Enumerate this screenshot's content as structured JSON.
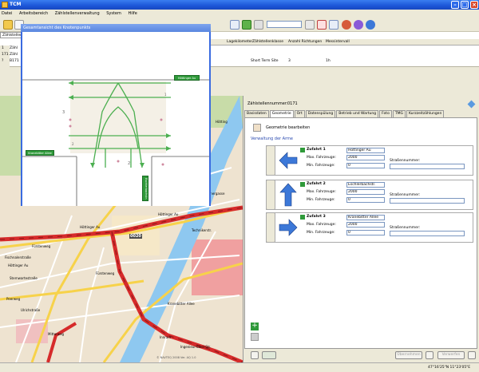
{
  "window": {
    "title": "TCM"
  },
  "menu": [
    "Datei",
    "Arbeitsbereich",
    "Zählstellenverwaltung",
    "System",
    "Hilfe"
  ],
  "grid": {
    "tab": "Zählstellen",
    "headers": [
      "Lagekilometer",
      "Zählstellenklasse",
      "Anzahl Richtungen",
      "Messintervall"
    ],
    "row": [
      "Short Term Site",
      "3",
      "1h"
    ],
    "row_headers": [
      "1",
      "171",
      "?"
    ],
    "row_labels": [
      "Zähl",
      "Zähl",
      "B171"
    ]
  },
  "popup": {
    "title": "Gesamtansicht des Knotenpunkts",
    "labels": [
      "Höttinger Au",
      "Eschlerbachstr.",
      "Kranebitter Allee"
    ],
    "lane_numbers": [
      "1",
      "2",
      "3",
      "2"
    ]
  },
  "panel": {
    "zaehlstellennummer_label": "Zählstellennummer:",
    "zaehlstellennummer_value": "0171",
    "tabs": [
      "Basisdaten",
      "Geometrie",
      "Ort",
      "Datenspülung",
      "Betrieb und Wartung",
      "Foto",
      "TMG",
      "Kurzzeitzählungen"
    ],
    "active_tab": "Geometrie",
    "edit_geometry": "Geometrie bearbeiten",
    "section": "Verwaltung der Arme",
    "arms": [
      {
        "title": "Zufahrt 1",
        "road": "Höttinger Au",
        "max_label": "Max. Fahrzeuge:",
        "max": "2000",
        "min_label": "Min. Fahrzeuge:",
        "min": "0",
        "street_label": "Straßennummer:",
        "street": "",
        "dir": "left"
      },
      {
        "title": "Zufahrt 2",
        "road": "Eschlerbachstr.",
        "max_label": "Max. Fahrzeuge:",
        "max": "2000",
        "min_label": "Min. Fahrzeuge:",
        "min": "0",
        "street_label": "Straßennummer:",
        "street": "",
        "dir": "up"
      },
      {
        "title": "Zufahrt 3",
        "road": "Kranebitter Allee",
        "max_label": "Max. Fahrzeuge:",
        "max": "2000",
        "min_label": "Min. Fahrzeuge:",
        "min": "0",
        "street_label": "Straßennummer:",
        "street": "",
        "dir": "right"
      }
    ],
    "buttons": {
      "apply": "Übernehmen",
      "discard": "Verwerfen"
    }
  },
  "map": {
    "station_id": "0020",
    "streets": [
      "Höttinger Au",
      "Höttinger Au",
      "Fürstenweg",
      "Technikerstr.",
      "Mitterweg",
      "Sternwartestraße",
      "Peerweg",
      "Ulrichstraße",
      "Kranebitter Allee",
      "Höttinger Au",
      "Fürstenweg",
      "Innrain",
      "Kapuzinergasse",
      "Hötting",
      "Fischnalerstraße",
      "Ingenieur-Etzel-Str."
    ],
    "copyright": "© NAVTEQ 2008 Ver. AQ 1.0"
  },
  "status": {
    "coords": "47°16'25\"N  11°23'05\"E"
  },
  "colors": {
    "titlebar": "#1c56d8",
    "road_primary": "#d62b2b",
    "road_secondary": "#f7d24a",
    "river": "#8ec8f0",
    "arrow": "#3c78d8",
    "green_label": "#2f9a3a"
  }
}
